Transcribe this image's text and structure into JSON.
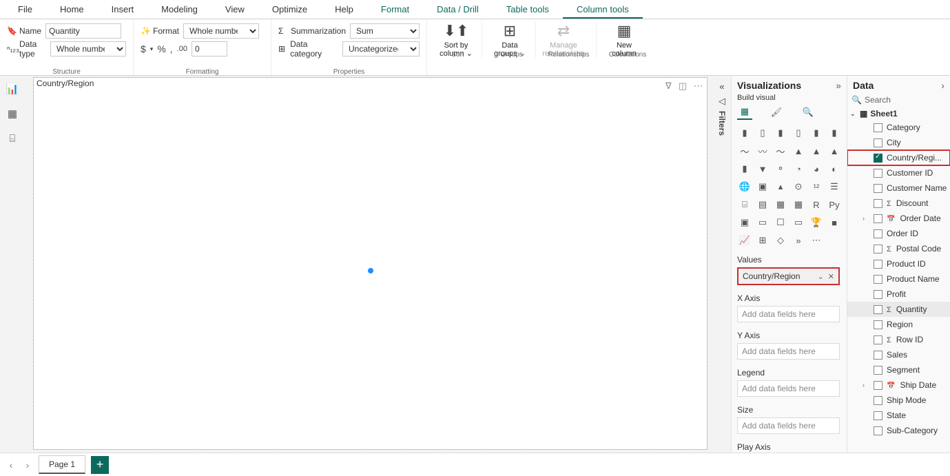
{
  "ribbon": {
    "tabs": [
      "File",
      "Home",
      "Insert",
      "Modeling",
      "View",
      "Optimize",
      "Help",
      "Format",
      "Data / Drill",
      "Table tools",
      "Column tools"
    ],
    "active_tab": 10,
    "accent_tabs": [
      7,
      8,
      9,
      10
    ],
    "structure": {
      "name_label": "Name",
      "name_value": "Quantity",
      "type_label": "Data type",
      "type_value": "Whole number",
      "group_label": "Structure"
    },
    "formatting": {
      "format_label": "Format",
      "format_value": "Whole number",
      "decimals_value": "0",
      "group_label": "Formatting"
    },
    "properties": {
      "sum_label": "Summarization",
      "sum_value": "Sum",
      "cat_label": "Data category",
      "cat_value": "Uncategorized",
      "group_label": "Properties"
    },
    "big_buttons": {
      "sort": {
        "line1": "Sort by",
        "line2": "column ⌄",
        "group": "Sort"
      },
      "groups": {
        "line1": "Data",
        "line2": "groups ⌄",
        "group": "Groups"
      },
      "rel": {
        "line1": "Manage",
        "line2": "relationships",
        "group": "Relationships"
      },
      "calc": {
        "line1": "New",
        "line2": "column",
        "group": "Calculations"
      }
    }
  },
  "viz_placeholder_title": "Country/Region",
  "filters_label": "Filters",
  "viz_panel": {
    "title": "Visualizations",
    "subtitle": "Build visual",
    "sections": {
      "values": "Values",
      "values_field": "Country/Region",
      "xaxis": "X Axis",
      "yaxis": "Y Axis",
      "legend": "Legend",
      "size": "Size",
      "play": "Play Axis",
      "placeholder": "Add data fields here"
    }
  },
  "data_panel": {
    "title": "Data",
    "search_ph": "Search",
    "table": "Sheet1",
    "fields": [
      {
        "name": "Category",
        "checked": false
      },
      {
        "name": "City",
        "checked": false
      },
      {
        "name": "Country/Regi...",
        "checked": true,
        "boxed": true
      },
      {
        "name": "Customer ID",
        "checked": false
      },
      {
        "name": "Customer Name",
        "checked": false
      },
      {
        "name": "Discount",
        "checked": false,
        "sigma": true
      },
      {
        "name": "Order Date",
        "checked": false,
        "date": true,
        "expandable": true
      },
      {
        "name": "Order ID",
        "checked": false
      },
      {
        "name": "Postal Code",
        "checked": false,
        "sigma": true
      },
      {
        "name": "Product ID",
        "checked": false
      },
      {
        "name": "Product Name",
        "checked": false
      },
      {
        "name": "Profit",
        "checked": false
      },
      {
        "name": "Quantity",
        "checked": false,
        "sigma": true,
        "highlight": true
      },
      {
        "name": "Region",
        "checked": false
      },
      {
        "name": "Row ID",
        "checked": false,
        "sigma": true
      },
      {
        "name": "Sales",
        "checked": false
      },
      {
        "name": "Segment",
        "checked": false
      },
      {
        "name": "Ship Date",
        "checked": false,
        "date": true,
        "expandable": true
      },
      {
        "name": "Ship Mode",
        "checked": false
      },
      {
        "name": "State",
        "checked": false
      },
      {
        "name": "Sub-Category",
        "checked": false
      }
    ]
  },
  "page_tab": "Page 1"
}
